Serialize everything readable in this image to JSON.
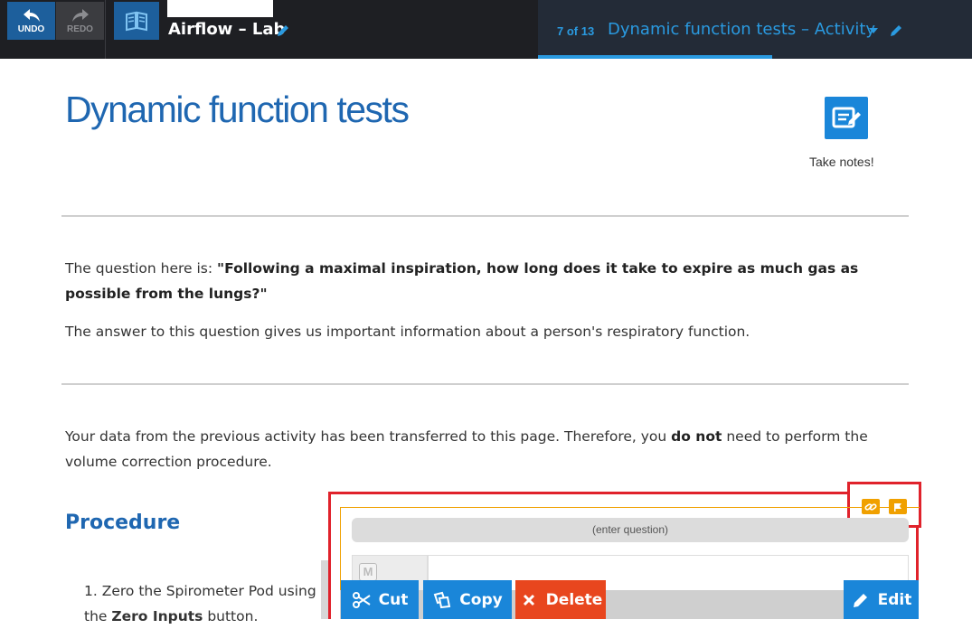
{
  "toolbar": {
    "undo_label": "UNDO",
    "redo_label": "REDO",
    "lab_title": "Airflow – Lab",
    "activity_counter": "7 of 13",
    "activity_title": "Dynamic function tests – Activity"
  },
  "page": {
    "title": "Dynamic function tests",
    "take_notes_label": "Take notes!",
    "question_intro": "The question here is: ",
    "question_text": "\"Following a maximal inspiration, how long does it take to expire as much gas as possible from the lungs?\"",
    "answer_text": "The answer to this question gives us important information about a person's respiratory function.",
    "data_text_1": "Your data from the previous activity has been transferred to this page. Therefore, you ",
    "data_text_bold": "do not",
    "data_text_2": " need to perform the volume correction procedure.",
    "procedure_heading": "Procedure",
    "step1_number": "1.",
    "step1_text_1": "Zero the Spirometer Pod using the ",
    "step1_text_bold": "Zero Inputs",
    "step1_text_2": " button."
  },
  "widget": {
    "question_placeholder": "(enter question)",
    "m_icon_label": "M",
    "cut_label": "Cut",
    "copy_label": "Copy",
    "delete_label": "Delete",
    "edit_label": "Edit"
  },
  "colors": {
    "accent_blue": "#1a86d9",
    "title_blue": "#1f67b1",
    "delete_orange": "#e8461e",
    "selection_red": "#e0222b",
    "widget_orange": "#f0a000"
  }
}
